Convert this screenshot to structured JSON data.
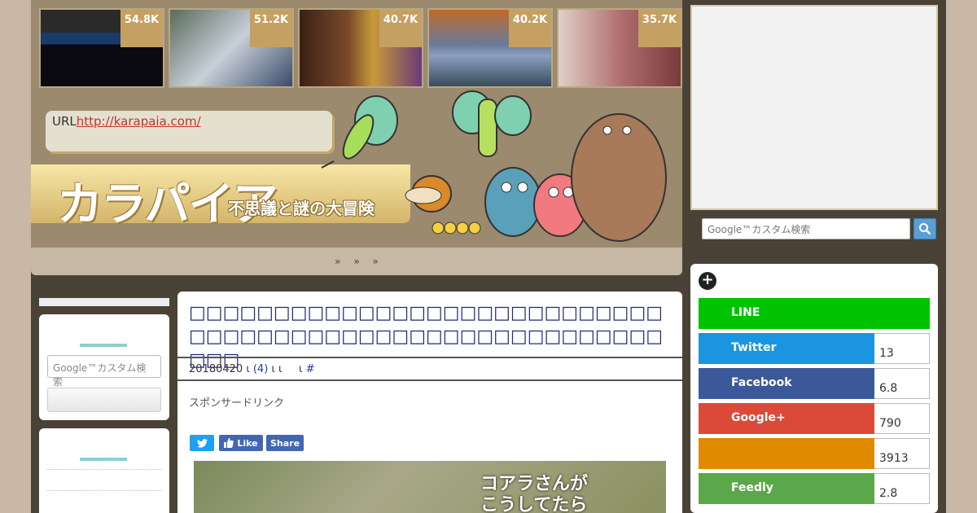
{
  "header": {
    "thumbs": [
      {
        "count": "54.8K",
        "bg": "linear-gradient(#2a2a2a 0 30%, #1a3a6a 30% 45%, #0a0a10 45%)"
      },
      {
        "count": "51.2K",
        "bg": "linear-gradient(135deg,#5a6a5a,#c8d0d8 50%,#3a4a6a)"
      },
      {
        "count": "40.7K",
        "bg": "linear-gradient(90deg,#3a2014,#7a4a2a 40%,#c89a3a 60%,#6a3a7a)"
      },
      {
        "count": "40.2K",
        "bg": "linear-gradient(#c06a2a,#6a7a9a 45%,#8aa0c0 60%,#3a4a5a)"
      },
      {
        "count": "35.7K",
        "bg": "linear-gradient(90deg,#e0d0c8,#b07070 50%,#7a3a3a)"
      }
    ],
    "url_label": "URL",
    "url": "http://karapaia.com/",
    "logo": "カラパイア",
    "subtitle": "不思議と謎の大冒険"
  },
  "nav": {
    "items": [
      "»",
      "»",
      "»"
    ]
  },
  "right": {
    "search_placeholder": "Google™カスタム検索",
    "share_buttons": [
      {
        "label": "LINE",
        "count": "",
        "color": "#00c300"
      },
      {
        "label": "Twitter",
        "count": "13",
        "color": "#1b95e0"
      },
      {
        "label": "Facebook",
        "count": "6.8",
        "color": "#3b5998"
      },
      {
        "label": "Google+",
        "count": "790",
        "color": "#db4a39"
      },
      {
        "label": "",
        "count": "3913",
        "color": "#e08a00"
      },
      {
        "label": "Feedly",
        "count": "2.8",
        "color": "#6cc655"
      }
    ]
  },
  "left_sidebar": {
    "search_placeholder": "Google™カスタム検索"
  },
  "article": {
    "title": "□□□□□□□□□□□□□□□□□□□□□□□□□□□□□□□□□□□□□□□□□□□□□□□□□□□□□□□□□□□",
    "date": "20180420",
    "sep1": "ι",
    "comments": "(4)",
    "sep2": "ι ι",
    "sep3": "ι",
    "hash": "#",
    "sponsor": "スポンサードリンク",
    "share": {
      "tweet": "",
      "like": "Like",
      "share": "Share"
    },
    "photo_caption": "コアラさんが\nこうしてたら"
  }
}
